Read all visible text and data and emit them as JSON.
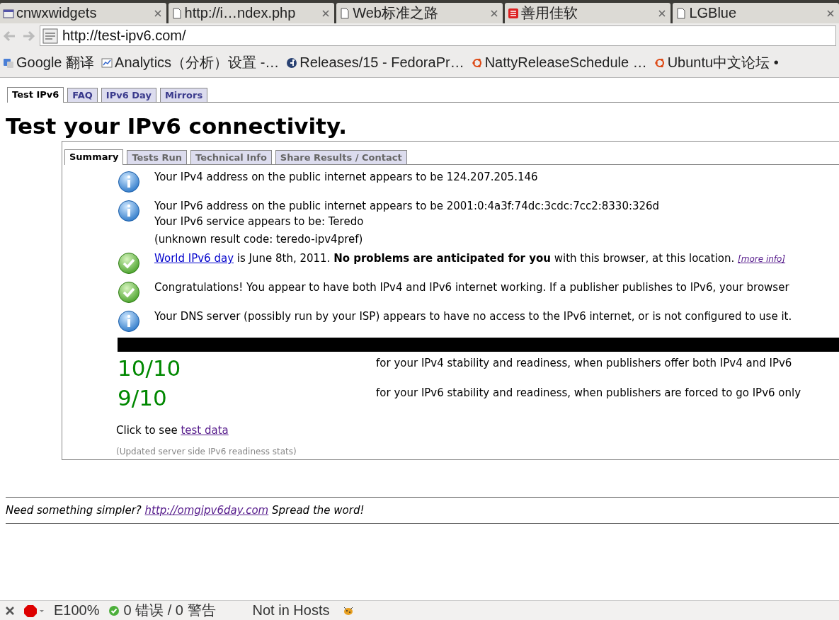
{
  "browser_tabs": [
    {
      "title": "cnwxwidgets",
      "kind": "window"
    },
    {
      "title": "http://i…ndex.php",
      "kind": "page"
    },
    {
      "title": "Web标准之路",
      "kind": "page"
    },
    {
      "title": "善用佳软",
      "kind": "red"
    },
    {
      "title": "LGBlue",
      "kind": "page"
    }
  ],
  "address": {
    "url": "http://test-ipv6.com/"
  },
  "bookmarks": [
    {
      "title": "Google 翻译",
      "kind": "translate"
    },
    {
      "title": "Analytics（分析）设置 -…",
      "kind": "chart"
    },
    {
      "title": "Releases/15 - FedoraPr…",
      "kind": "fedora"
    },
    {
      "title": "NattyReleaseSchedule …",
      "kind": "ubuntu"
    },
    {
      "title": "Ubuntu中文论坛 •",
      "kind": "ubuntu"
    }
  ],
  "site_tabs": [
    {
      "label": "Test IPv6",
      "selected": true
    },
    {
      "label": "FAQ",
      "selected": false
    },
    {
      "label": "IPv6 Day",
      "selected": false
    },
    {
      "label": "Mirrors",
      "selected": false
    }
  ],
  "heading": "Test your IPv6 connectivity.",
  "result_tabs": [
    {
      "label": "Summary",
      "selected": true
    },
    {
      "label": "Tests Run",
      "selected": false
    },
    {
      "label": "Technical Info",
      "selected": false
    },
    {
      "label": "Share Results / Contact",
      "selected": false
    }
  ],
  "messages": [
    {
      "kind": "info",
      "lines": [
        "Your IPv4 address on the public internet appears to be 124.207.205.146"
      ]
    },
    {
      "kind": "info",
      "lines": [
        "Your IPv6 address on the public internet appears to be 2001:0:4a3f:74dc:3cdc:7cc2:8330:326d",
        "Your IPv6 service appears to be: Teredo",
        "(unknown result code: teredo-ipv4pref)"
      ]
    },
    {
      "kind": "ok",
      "link": "World IPv6 day",
      "text": " is June 8th, 2011. **No problems are anticipated for you** with this browser, at this location. ",
      "more_info": "[more info]"
    },
    {
      "kind": "ok",
      "lines": [
        "Congratulations! You appear to have both IPv4 and IPv6 internet working. If a publisher publishes to IPv6, your browser"
      ]
    },
    {
      "kind": "info",
      "lines": [
        "Your DNS server (possibly run by your ISP) appears to have no access to the IPv6 internet, or is not configured to use it."
      ]
    }
  ],
  "scores": [
    {
      "score": "10/10",
      "description": "for your IPv4 stability and readiness, when publishers offer both IPv4 and IPv6"
    },
    {
      "score": "9/10",
      "description": "for your IPv6 stability and readiness, when publishers are forced to go IPv6 only"
    }
  ],
  "test_data": {
    "text": "Click to see",
    "link": "test data"
  },
  "stats_note": "(Updated server side IPv6 readiness stats)",
  "footer": {
    "before": "Need something simpler?",
    "link": "http://omgipv6day.com",
    "after": "Spread the word!"
  },
  "status_bar": {
    "zoom": "E100%",
    "errors": "0 错误 / 0 警告",
    "hosts": "Not in Hosts"
  }
}
